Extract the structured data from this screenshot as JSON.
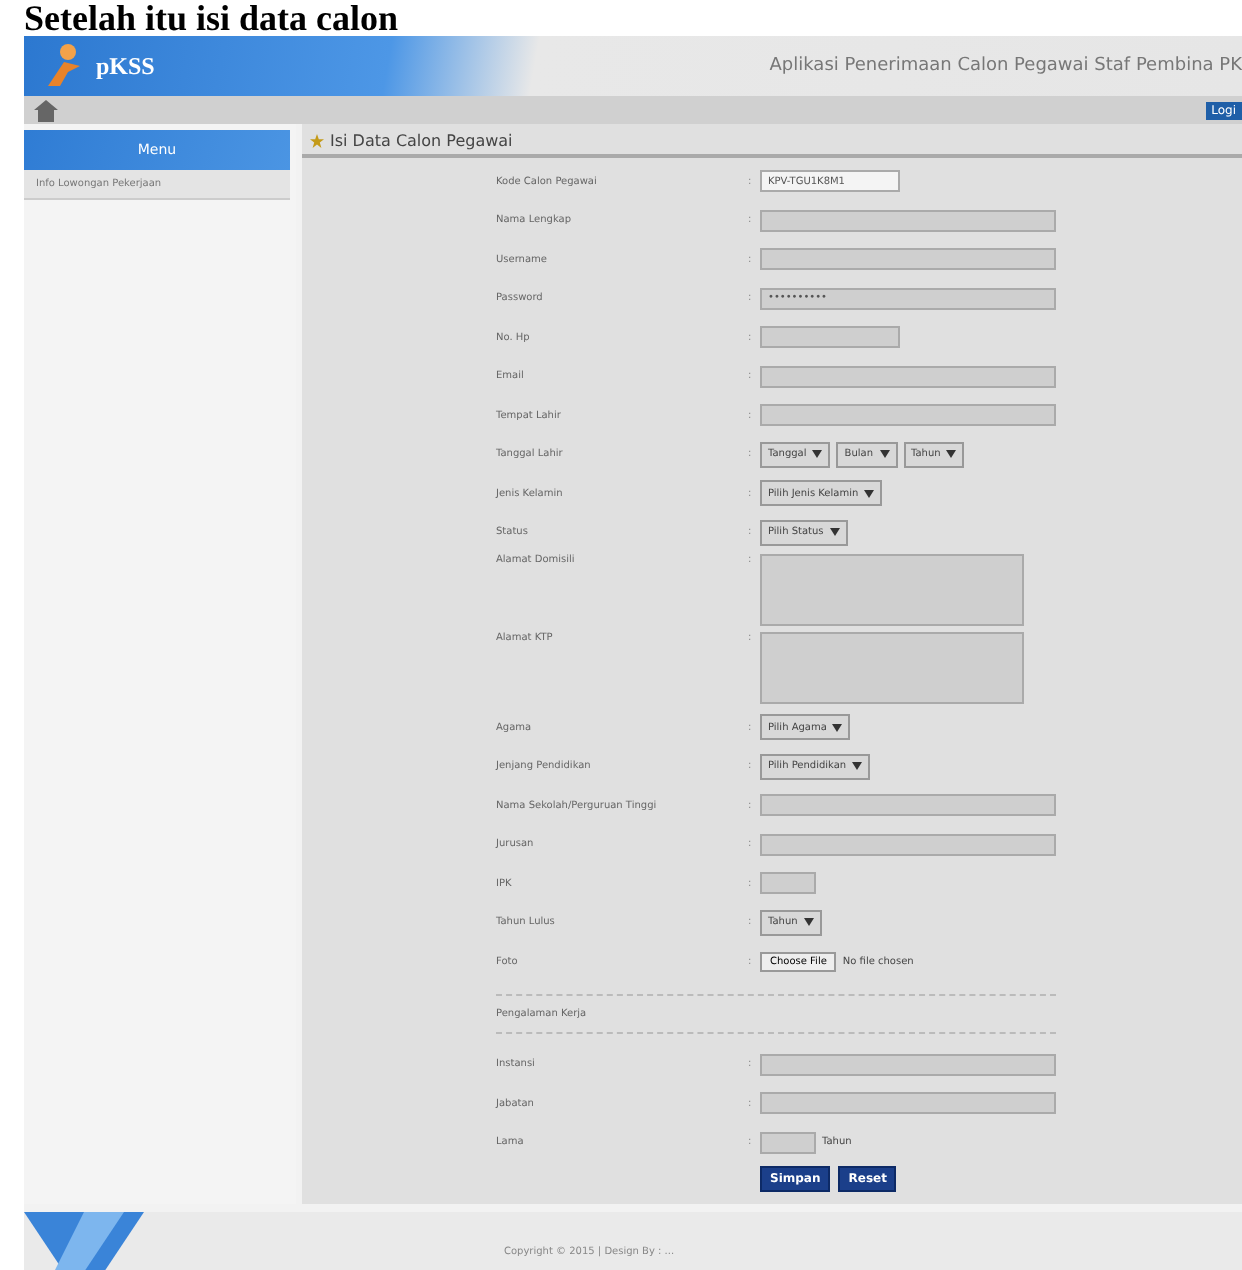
{
  "caption": "Setelah itu isi data calon",
  "header": {
    "logo": "pKSS",
    "title": "Aplikasi Penerimaan Calon Pegawai Staf Pembina PK"
  },
  "nav": {
    "login": "Logi"
  },
  "sidebar": {
    "title": "Menu",
    "items": [
      "Info Lowongan Pekerjaan"
    ]
  },
  "panel": {
    "title": "Isi Data Calon Pegawai"
  },
  "fields": [
    {
      "kind": "code",
      "label": "Kode Calon Pegawai",
      "separator": ":",
      "value": "KPV-TGU1K8M1"
    },
    {
      "kind": "text",
      "label": "Nama Lengkap",
      "separator": ":"
    },
    {
      "kind": "text",
      "label": "Username",
      "separator": ":"
    },
    {
      "kind": "text",
      "label": "Password",
      "separator": ":",
      "value": "••••••••••"
    },
    {
      "kind": "short",
      "label": "No. Hp",
      "separator": ":"
    },
    {
      "kind": "text",
      "label": "Email",
      "separator": ":"
    },
    {
      "kind": "text",
      "label": "Tempat Lahir",
      "separator": ":"
    },
    {
      "kind": "select",
      "label": "Tanggal Lahir",
      "separator": ":",
      "options": [
        "Tanggal",
        "Bulan",
        "Tahun"
      ]
    },
    {
      "kind": "select",
      "label": "Jenis Kelamin",
      "separator": ":",
      "options": [
        "Pilih Jenis Kelamin"
      ]
    },
    {
      "kind": "select",
      "label": "Status",
      "separator": ":",
      "options": [
        "Pilih Status"
      ]
    },
    {
      "kind": "textarea",
      "label": "Alamat Domisili",
      "separator": ":"
    },
    {
      "kind": "textarea",
      "label": "Alamat KTP",
      "separator": ":"
    },
    {
      "kind": "select",
      "label": "Agama",
      "separator": ":",
      "options": [
        "Pilih Agama"
      ]
    },
    {
      "kind": "select",
      "label": "Jenjang Pendidikan",
      "separator": ":",
      "options": [
        "Pilih Pendidikan"
      ]
    },
    {
      "kind": "text",
      "label": "Nama Sekolah/Perguruan Tinggi",
      "separator": ":"
    },
    {
      "kind": "text",
      "label": "Jurusan",
      "separator": ":"
    },
    {
      "kind": "tiny",
      "label": "IPK",
      "separator": ":"
    },
    {
      "kind": "select",
      "label": "Tahun Lulus",
      "separator": ":",
      "options": [
        "Tahun"
      ]
    },
    {
      "kind": "file",
      "label": "Foto",
      "separator": ":",
      "button": "Choose File",
      "status": "No file chosen"
    },
    {
      "kind": "section",
      "label": "Pengalaman Kerja"
    },
    {
      "kind": "text",
      "label": "Instansi",
      "separator": ":"
    },
    {
      "kind": "text",
      "label": "Jabatan",
      "separator": ":"
    },
    {
      "kind": "tiny",
      "label": "Lama",
      "separator": ":",
      "suffix": "Tahun"
    }
  ],
  "buttons": [
    "Simpan",
    "Reset"
  ],
  "footer": "Copyright © 2015 | Design By : ..."
}
